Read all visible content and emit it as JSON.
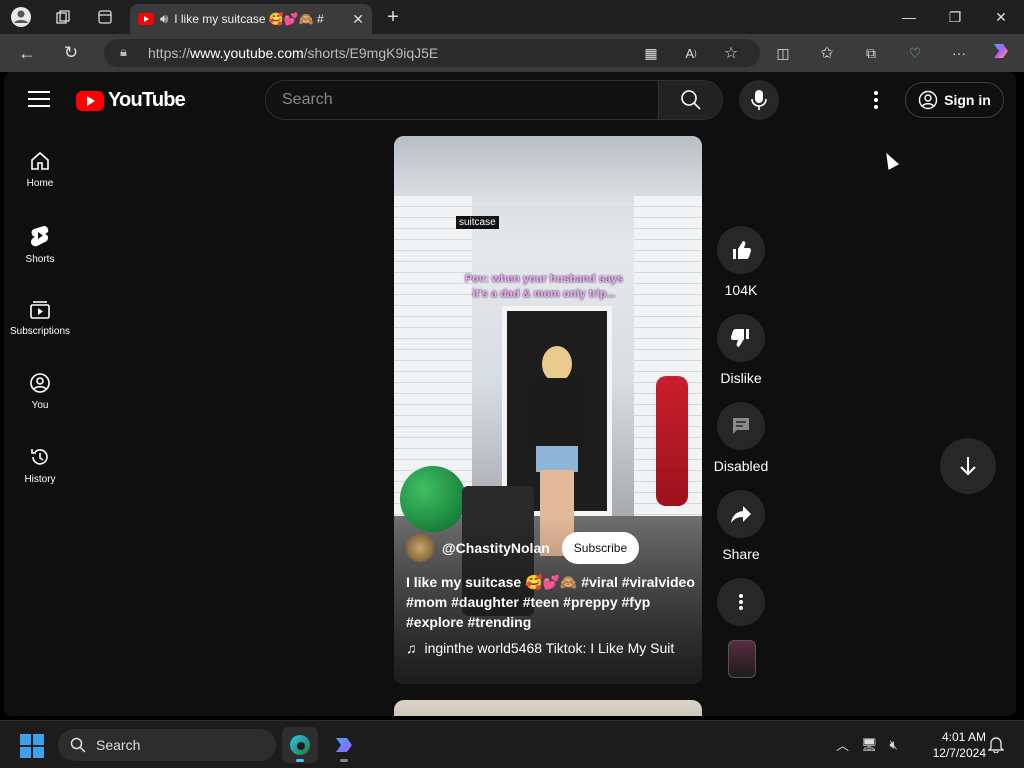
{
  "browser": {
    "tab_title": "I like my suitcase 🥰💕🙈 #",
    "url_prefix": "https://",
    "url_domain": "www.youtube.com",
    "url_path": "/shorts/E9mgK9iqJ5E"
  },
  "header": {
    "logo_text": "YouTube",
    "search_placeholder": "Search",
    "signin_label": "Sign in"
  },
  "sidebar": {
    "items": [
      {
        "label": "Home",
        "icon": "home-icon"
      },
      {
        "label": "Shorts",
        "icon": "shorts-icon"
      },
      {
        "label": "Subscriptions",
        "icon": "subscriptions-icon"
      },
      {
        "label": "You",
        "icon": "you-icon"
      },
      {
        "label": "History",
        "icon": "history-icon"
      }
    ]
  },
  "short": {
    "sticker_text": "suitcase",
    "overlay_caption": "Pov: when your husband says it's a dad & mom only trip...",
    "channel": "@ChastityNolan",
    "subscribe_label": "Subscribe",
    "title": "I like my suitcase 🥰💕🙈 #viral #viralvideo #mom #daughter #teen #preppy #fyp #explore #trending",
    "music": "inginthe world5468    Tiktok: I Like My Suit"
  },
  "actions": {
    "like_count": "104K",
    "dislike_label": "Dislike",
    "comments_label": "Disabled",
    "share_label": "Share"
  },
  "taskbar": {
    "search_label": "Search",
    "time": "4:01 AM",
    "date": "12/7/2024"
  },
  "colors": {
    "brand": "#ff0000",
    "page_bg": "#0f0f0f",
    "button_bg": "#272727"
  }
}
